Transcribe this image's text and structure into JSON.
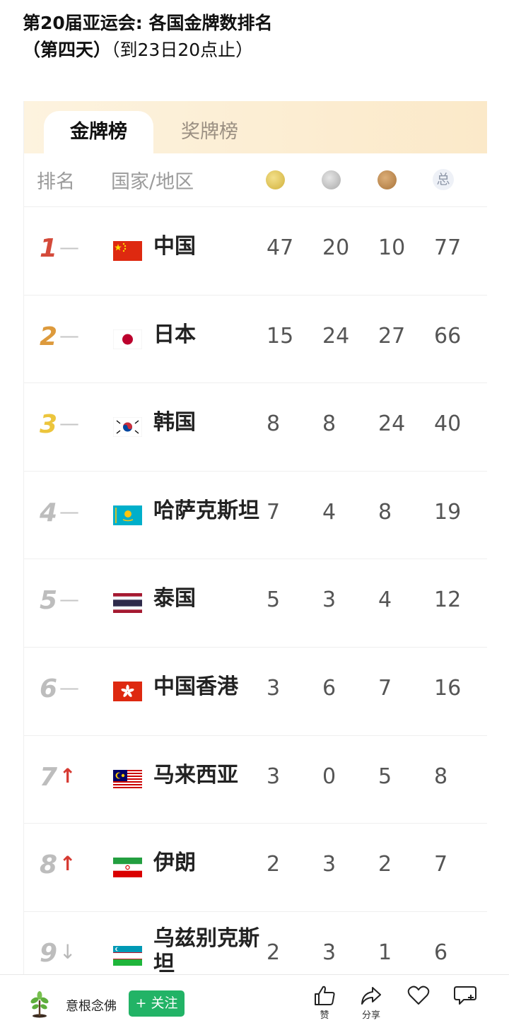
{
  "article": {
    "title_line1": "第20届亚运会: 各国金牌数排名",
    "title_line2_bold": "（第四天）",
    "title_line2_normal": "（到23日20点止）"
  },
  "tabs": [
    {
      "label": "金牌榜",
      "active": true
    },
    {
      "label": "奖牌榜",
      "active": false
    }
  ],
  "header": {
    "rank": "排名",
    "country": "国家/地区",
    "gold_icon": "gold-medal-icon",
    "silver_icon": "silver-medal-icon",
    "bronze_icon": "bronze-medal-icon",
    "total": "总"
  },
  "rows": [
    {
      "rank": "1",
      "trend": "—",
      "trend_type": "flat",
      "flag": "china",
      "country": "中国",
      "gold": "47",
      "silver": "20",
      "bronze": "10",
      "total": "77"
    },
    {
      "rank": "2",
      "trend": "—",
      "trend_type": "flat",
      "flag": "japan",
      "country": "日本",
      "gold": "15",
      "silver": "24",
      "bronze": "27",
      "total": "66"
    },
    {
      "rank": "3",
      "trend": "—",
      "trend_type": "flat",
      "flag": "korea",
      "country": "韩国",
      "gold": "8",
      "silver": "8",
      "bronze": "24",
      "total": "40"
    },
    {
      "rank": "4",
      "trend": "—",
      "trend_type": "flat",
      "flag": "kazakhstan",
      "country": "哈萨克斯坦",
      "gold": "7",
      "silver": "4",
      "bronze": "8",
      "total": "19"
    },
    {
      "rank": "5",
      "trend": "—",
      "trend_type": "flat",
      "flag": "thailand",
      "country": "泰国",
      "gold": "5",
      "silver": "3",
      "bronze": "4",
      "total": "12"
    },
    {
      "rank": "6",
      "trend": "—",
      "trend_type": "flat",
      "flag": "hongkong",
      "country": "中国香港",
      "gold": "3",
      "silver": "6",
      "bronze": "7",
      "total": "16"
    },
    {
      "rank": "7",
      "trend": "↑",
      "trend_type": "up",
      "flag": "malaysia",
      "country": "马来西亚",
      "gold": "3",
      "silver": "0",
      "bronze": "5",
      "total": "8"
    },
    {
      "rank": "8",
      "trend": "↑",
      "trend_type": "up",
      "flag": "iran",
      "country": "伊朗",
      "gold": "2",
      "silver": "3",
      "bronze": "2",
      "total": "7"
    },
    {
      "rank": "9",
      "trend": "↓",
      "trend_type": "down",
      "flag": "uzbekistan",
      "country": "乌兹别克斯坦",
      "gold": "2",
      "silver": "3",
      "bronze": "1",
      "total": "6"
    }
  ],
  "bottom_bar": {
    "avatar_icon": "tree-avatar-icon",
    "author": "意根念佛",
    "follow_label": "+ 关注",
    "actions": [
      {
        "icon": "thumbs-up-icon",
        "label": "赞"
      },
      {
        "icon": "share-icon",
        "label": "分享"
      },
      {
        "icon": "heart-icon",
        "label": ""
      },
      {
        "icon": "comment-icon",
        "label": ""
      }
    ]
  },
  "colors": {
    "follow_green": "#22b366",
    "rank1": "#d44a3a",
    "rank2": "#dd9a3c",
    "rank3": "#ecc53c",
    "trend_up": "#d63a32"
  }
}
